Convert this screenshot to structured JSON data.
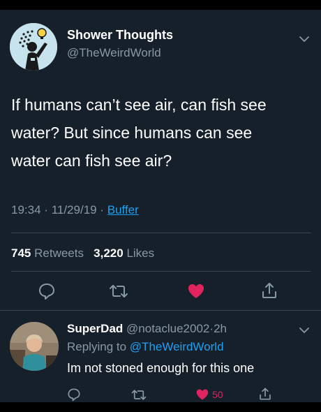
{
  "colors": {
    "background": "#15202b",
    "text": "#ffffff",
    "secondary": "#8899a6",
    "link": "#1da1f2",
    "like": "#e0245e",
    "divider": "#38444d"
  },
  "tweet": {
    "display_name": "Shower Thoughts",
    "handle": "@TheWeirdWorld",
    "text_lines": [
      "If humans can’t see air, can fish see",
      "water? But since humans can see",
      "water can fish see air?"
    ],
    "time": "19:34",
    "date": "11/29/19",
    "separator": "·",
    "source": "Buffer",
    "retweet_count": "745",
    "retweet_label": "Retweets",
    "like_count": "3,220",
    "like_label": "Likes",
    "liked": true,
    "icons": [
      "reply-icon",
      "retweet-icon",
      "like-icon",
      "share-icon"
    ]
  },
  "reply": {
    "display_name": "SuperDad",
    "handle": "@notaclue2002",
    "separator": "·",
    "time_ago": "2h",
    "replying_prefix": "Replying to",
    "replying_to": "@TheWeirdWorld",
    "text": "Im not stoned enough for this one",
    "like_count": "50",
    "liked": true,
    "icons": [
      "reply-icon",
      "retweet-icon",
      "like-icon",
      "share-icon"
    ]
  }
}
